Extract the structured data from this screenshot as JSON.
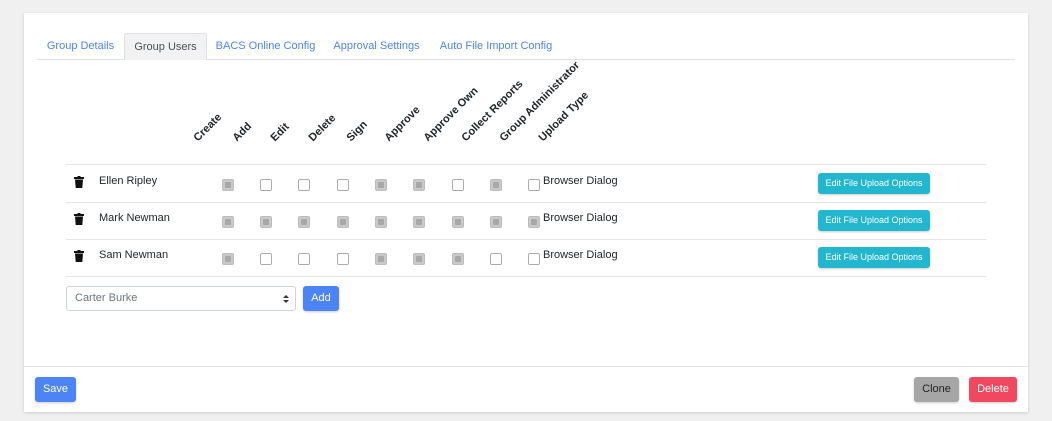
{
  "tabs": [
    {
      "label": "Group Details",
      "active": false
    },
    {
      "label": "Group Users",
      "active": true
    },
    {
      "label": "BACS Online Config",
      "active": false
    },
    {
      "label": "Approval Settings",
      "active": false
    },
    {
      "label": "Auto File Import Config",
      "active": false
    }
  ],
  "columns": [
    "Create",
    "Add",
    "Edit",
    "Delete",
    "Sign",
    "Approve",
    "Approve Own",
    "Collect Reports",
    "Group Administrator",
    "Upload Type"
  ],
  "users": [
    {
      "name": "Ellen Ripley",
      "perms": [
        true,
        false,
        false,
        false,
        true,
        true,
        false,
        true,
        false
      ],
      "upload_type": "Browser Dialog",
      "upload_button": "Edit File Upload Options"
    },
    {
      "name": "Mark Newman",
      "perms": [
        true,
        true,
        true,
        true,
        true,
        true,
        true,
        true,
        true
      ],
      "upload_type": "Browser Dialog",
      "upload_button": "Edit File Upload Options"
    },
    {
      "name": "Sam Newman",
      "perms": [
        true,
        false,
        false,
        false,
        true,
        true,
        true,
        false,
        false
      ],
      "upload_type": "Browser Dialog",
      "upload_button": "Edit File Upload Options"
    }
  ],
  "add_user": {
    "selected": "Carter Burke",
    "button": "Add"
  },
  "footer": {
    "save": "Save",
    "clone": "Clone",
    "delete": "Delete"
  },
  "colors": {
    "primary": "#4c84f5",
    "info": "#22b6cf",
    "danger": "#f0485e",
    "secondary": "#a6a6a6"
  }
}
